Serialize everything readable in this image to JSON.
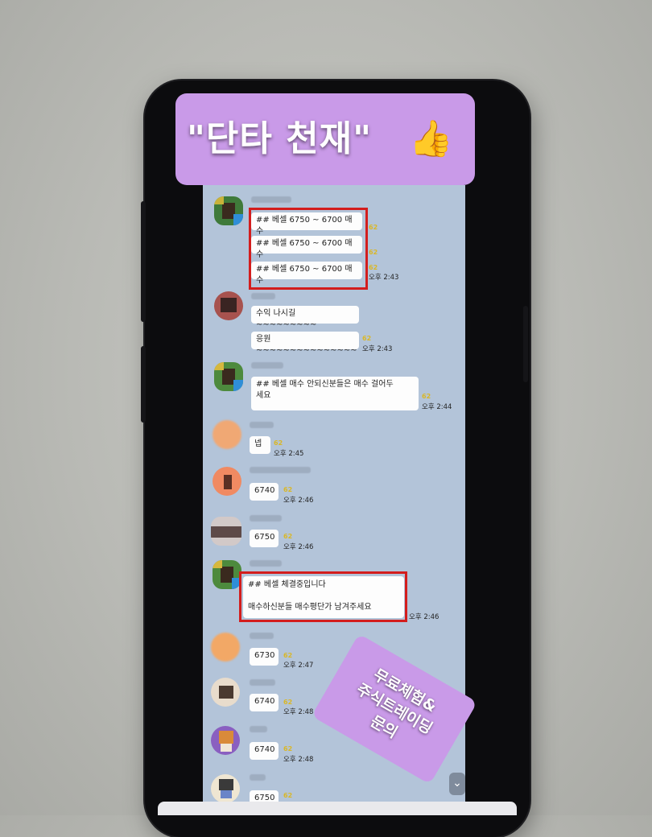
{
  "banner": {
    "title": "\"단타 천재\"",
    "emoji": "👍"
  },
  "promo": {
    "line1": "무료체험&",
    "line2": "주식트레이딩",
    "line3": "문의"
  },
  "messages": [
    {
      "bubbles": [
        "## 베셀 6750 ~ 6700 매수",
        "## 베셀 6750 ~ 6700 매수",
        "## 베셀 6750 ~ 6700 매수"
      ],
      "unread": "62",
      "time": "오후 2:43"
    },
    {
      "bubbles": [
        "수익 나시길~~~~~~~~~",
        "응원~~~~~~~~~~~~~~~"
      ],
      "unread": "62",
      "time": "오후 2:43"
    },
    {
      "bubbles": [
        "## 베셀 매수 안되신분들은 매수 걸어두\n세요"
      ],
      "unread": "62",
      "time": "오후 2:44"
    },
    {
      "bubbles": [
        "넵"
      ],
      "unread": "62",
      "time": "오후 2:45"
    },
    {
      "bubbles": [
        "6740"
      ],
      "unread": "62",
      "time": "오후 2:46"
    },
    {
      "bubbles": [
        "6750"
      ],
      "unread": "62",
      "time": "오후 2:46"
    },
    {
      "bubbles": [
        "## 베셀 체결중입니다\n\n매수하신분들 매수평단가 남겨주세요"
      ],
      "unread": "62",
      "time": "오후 2:46"
    },
    {
      "bubbles": [
        "6730"
      ],
      "unread": "62",
      "time": "오후 2:47"
    },
    {
      "bubbles": [
        "6740"
      ],
      "unread": "62",
      "time": "오후 2:48"
    },
    {
      "bubbles": [
        "6740"
      ],
      "unread": "62",
      "time": "오후 2:48"
    },
    {
      "bubbles": [
        "6750"
      ],
      "unread": "62",
      "time": ""
    }
  ],
  "scroll_down_icon": "chevron-down-icon",
  "colors": {
    "banner": "#c99ae8",
    "chat_background": "#b3c4d9",
    "highlight": "#d31d1d",
    "unread_count": "#d9b728"
  }
}
